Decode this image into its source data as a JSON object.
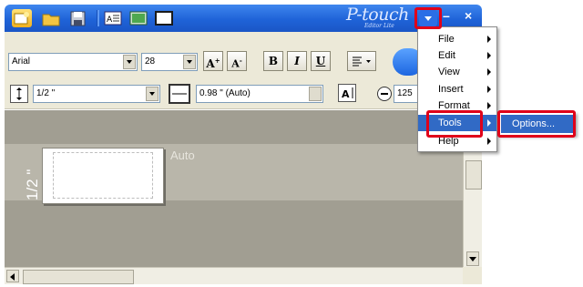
{
  "app": {
    "brand_logo_text": "P-touch",
    "brand_sub_text": "Editor Lite",
    "minimize_glyph": "–",
    "close_glyph": "×"
  },
  "toolbar": {
    "font_value": "Arial",
    "size_value": "28",
    "bold_label": "B",
    "italic_label": "I",
    "underline_label": "U",
    "tape_width_value": "1/2 \"",
    "length_value": "0.98 \" (Auto)",
    "zoom_value": "125"
  },
  "canvas": {
    "tape_width_label": "1/2 \"",
    "length_label": "Auto"
  },
  "menu": {
    "items": [
      {
        "label": "File"
      },
      {
        "label": "Edit"
      },
      {
        "label": "View"
      },
      {
        "label": "Insert"
      },
      {
        "label": "Format"
      },
      {
        "label": "Tools"
      },
      {
        "label": "Help"
      }
    ],
    "submenu": {
      "label": "Options..."
    }
  },
  "colors": {
    "titlebar": "#1f63d8",
    "highlight": "#316ac5",
    "callout": "#e0001a"
  }
}
